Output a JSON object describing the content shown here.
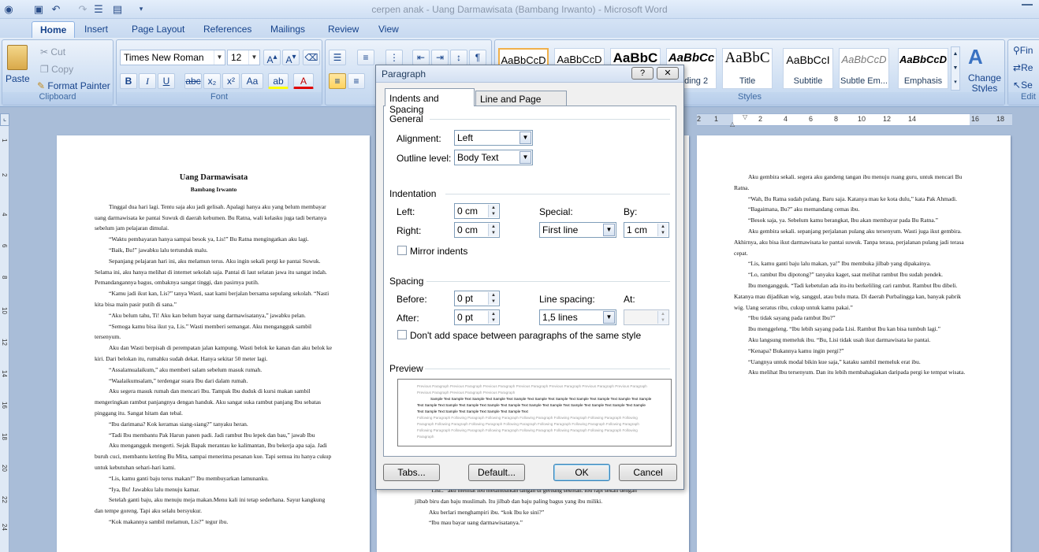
{
  "window": {
    "title": "cerpen anak - Uang Darmawisata (Bambang Irwanto) - Microsoft Word"
  },
  "ribbon_tabs": [
    "Home",
    "Insert",
    "Page Layout",
    "References",
    "Mailings",
    "Review",
    "View"
  ],
  "clipboard": {
    "paste": "Paste",
    "cut": "Cut",
    "copy": "Copy",
    "format_painter": "Format Painter",
    "label": "Clipboard"
  },
  "font": {
    "name": "Times New Roman",
    "size": "12",
    "label": "Font"
  },
  "styles": {
    "label": "Styles",
    "items": [
      {
        "sample": "AaBbCcD",
        "name": ""
      },
      {
        "sample": "AaBbCcD",
        "name": ""
      },
      {
        "sample": "AaBbC",
        "name": ""
      },
      {
        "sample": "AaBbCc",
        "name": "eading 2"
      },
      {
        "sample": "AaBbC",
        "name": "Title"
      },
      {
        "sample": "AaBbCcI",
        "name": "Subtitle"
      },
      {
        "sample": "AaBbCcD",
        "name": "Subtle Em..."
      },
      {
        "sample": "AaBbCcD",
        "name": "Emphasis"
      }
    ],
    "change_styles": "Change Styles",
    "change_styles_line2": "Styles"
  },
  "editing": {
    "find": "Fin",
    "replace": "Re",
    "select": "Se",
    "label": "Edit"
  },
  "ruler_left": [
    "1",
    "2",
    "4",
    "6",
    "8",
    "10",
    "12",
    "14",
    "16",
    "18",
    "20",
    "22",
    "24"
  ],
  "ruler_right": [
    "2",
    "1",
    "2",
    "4",
    "6",
    "8",
    "10",
    "12",
    "14",
    "16",
    "18"
  ],
  "page1": {
    "title": "Uang Darmawisata",
    "author": "Bambang Irwanto",
    "paragraphs": [
      "Tinggal dua hari lagi. Tentu saja aku jadi gelisah. Apalagi hanya aku yang belum membayar uang darmawisata ke pantai Suwuk di daerah kebumen. Bu Ratna, wali kelasku juga tadi bertanya sebelum jam pelajaran dimulai.",
      "“Waktu pembayaran hanya sampai besok ya, Lis!” Bu Ratna mengingatkan aku lagi.",
      "“Baik, Bu!” jawabku lalu tertunduk malu.",
      "Sepanjang pelajaran hari ini, aku melamun terus. Aku ingin sekali pergi ke pantai Suwuk. Selama ini, aku hanya melihat di internet sekolah saja. Pantai di laut selatan  jawa itu sangat indah. Pemandangannya bagus, ombaknya sangat tinggi, dan pasirnya putih.",
      "“Kamu jadi ikut kan, Lis?” tanya Wasti, saat kami berjalan bersama sepulang sekolah. “Nasti kita bisa main pasir putih di sana.”",
      "“Aku belum tahu, Ti! Aku kan belum bayar uang darmawisatanya,” jawabku pelan.",
      "“Semoga kamu bisa ikut ya, Lis.” Wasti memberi semangat. Aku mengangguk sambil tersenyum.",
      "Aku dan Wasti berpisah di perempatan jalan kampung. Wasti belok ke kanan dan aku belok ke kiri. Dari belokan itu, rumahku sudah dekat. Hanya sekitar 50 meter lagi.",
      "“Assalamualaikum,” aku memberi salam sebelum masuk rumah.",
      "“Waalaikumsalam,” terdengar suara Ibu dari dalam rumah.",
      "Aku segera masuk rumah dan mencari Ibu. Tampak Ibu duduk di kursi makan sambil mengeringkan rambut panjangnya dengan handuk. Aku sangat suka rambut panjang Ibu sebatas pinggang itu. Sangat hitam dan tebal.",
      "“Ibu darimana? Kok keramas siang-siang?” tanyaku heran.",
      "“Tadi Ibu membantu Pak Harun panen padi. Jadi rambut Ibu lepek dan bau,” jawab Ibu",
      "Aku mengangguk mengerti. Sejak Bapak merantau ke kalimantan, Ibu bekerja apa saja. Jadi buruh cuci, membantu ketring Bu Mita, sampai menerima pesanan kue. Tapi semua itu hanya cukup untuk kebutuhan sehari-hari kami.",
      "“Lis, kamu ganti baju terus makan!” Ibu membuyarkan lamunanku.",
      "“Iya, Bu! Jawabku lalu menuju kamar.",
      "Setelah ganti baju, aku menuju meja makan.Menu kali ini tetap sederhana. Sayur kangkung dan tempe goreng. Tapi aku selalu bersyukur.",
      "“Kok makannya sambil melamun, Lis?” tegur ibu."
    ]
  },
  "page2_visible": [
    "“Lisi..” aku melihat Ibu melambaikan tangan di gerbang sekolah. Ibu rapi sekali dengan jilbab biru dan baju muslimah. Itu jilbab dan baju paling bagus yang ibu miliki.",
    "Aku berlari menghampiri ibu. “kok Ibu ke sini?”",
    "“Ibu mau bayar uang darmawisatanya.”"
  ],
  "page3": [
    "Aku gembira sekali. segera aku gandeng tangan ibu menuju ruang guru, untuk mencari Bu Ratna.",
    "“Wah, Bu Ratna sudah pulang. Baru saja. Katanya mau ke kota dulu,” kata Pak Ahmadi.",
    "“Bagaimana, Bu?” aku memandang cemas ibu.",
    "“Besok saja, ya. Sebelum kamu berangkat, Ibu akan membayar pada Bu Ratna.”",
    "Aku gembira sekali. sepanjang perjalanan pulang aku tersenyum. Wasti juga ikut gembira. Akhirnya, aku bisa ikut darmawisata ke pantai suwuk. Tanpa terasa, perjalanan pulang jadi terasa cepat.",
    "“Lis, kamu ganti baju lalu makan, ya!” Ibu membuka jilbab yang dipakainya.",
    "“Lo, rambut Ibu dipotong?” tanyaku kaget, saat melihat rambut Ibu sudah pendek.",
    "Ibu mengangguk. “Tadi kebetulan ada itu-itu berkeliling cari rambut. Rambut Ibu dibeli. Katanya mau dijadikan wig, sanggul, atau bulu mata. Di daerah Purbalingga kan, banyak pabrik wig. Uang seratus ribu, cukup untuk kamu pakai.”",
    "“Ibu tidak sayang pada rambut Ibu?”",
    "Ibu menggeleng. “Ibu lebih sayang pada Lisi. Rambut Ibu kan bisa tumbuh lagi.”",
    "Aku langsung memeluk ibu. “Bu, Lisi tidak usah ikut darmawisata ke pantai.",
    "“Kenapa? Bukannya kamu ingin pergi?”",
    "“Uangnya untuk modal bikin kue saja,” kataku sambil memeluk erat ibu.",
    "Aku melihat Ibu tersenyum. Dan itu lebih membahagiakan daripada pergi ke tempat wisata."
  ],
  "dialog": {
    "title": "Paragraph",
    "tabs": [
      "Indents and Spacing",
      "Line and Page Breaks"
    ],
    "general": "General",
    "alignment_label": "Alignment:",
    "alignment_value": "Left",
    "outline_label": "Outline level:",
    "outline_value": "Body Text",
    "indentation": "Indentation",
    "left_label": "Left:",
    "left_value": "0 cm",
    "right_label": "Right:",
    "right_value": "0 cm",
    "special_label": "Special:",
    "special_value": "First line",
    "by_label": "By:",
    "by_value": "1 cm",
    "mirror_label": "Mirror indents",
    "spacing": "Spacing",
    "before_label": "Before:",
    "before_value": "0 pt",
    "after_label": "After:",
    "after_value": "0 pt",
    "line_spacing_label": "Line spacing:",
    "line_spacing_value": "1,5 lines",
    "at_label": "At:",
    "at_value": "",
    "no_space_label": "Don't add space between paragraphs of the same style",
    "preview": "Preview",
    "preview_prev": "Previous Paragraph Previous Paragraph Previous Paragraph Previous Paragraph Previous Paragraph Previous Paragraph Previous Paragraph Previous Paragraph Previous Paragraph Previous Paragraph",
    "preview_sample": "Sample Text Sample Text Sample Text Sample Text Sample Text Sample Text Sample Text Sample Text Sample Text Sample Text Sample Text Sample Text Sample Text Sample Text Sample Text Sample Text Sample Text Sample Text Sample Text Sample Text Sample Text Sample Text Sample Text Sample Text Sample Text Sample Text Sample Text",
    "preview_follow": "Following Paragraph Following Paragraph Following Paragraph Following Paragraph Following Paragraph Following Paragraph Following Paragraph Following Paragraph Following Paragraph Following Paragraph Following Paragraph Following Paragraph Following Paragraph Following Paragraph Following Paragraph Following Paragraph Following Paragraph Following Paragraph Following Paragraph Following Paragraph",
    "tabs_btn": "Tabs...",
    "default_btn": "Default...",
    "ok_btn": "OK",
    "cancel_btn": "Cancel"
  }
}
